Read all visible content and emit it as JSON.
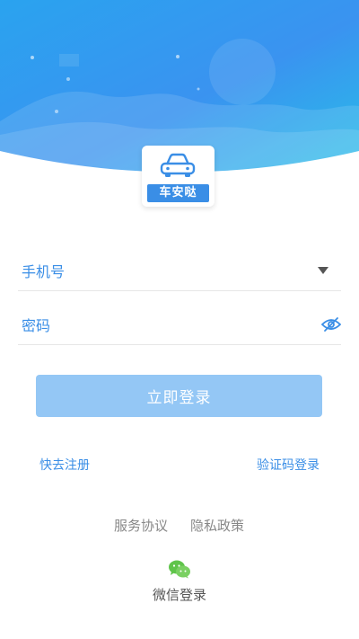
{
  "colors": {
    "accent": "#3a8ee6",
    "hero_top": "#29b6ee",
    "hero_bottom": "#3d8ff0",
    "button_disabled": "#94c7f5"
  },
  "logo": {
    "icon": "car-icon",
    "app_name": "车安哒"
  },
  "form": {
    "phone_placeholder": "手机号",
    "phone_value": "",
    "phone_dropdown_icon": "triangle-down-icon",
    "password_placeholder": "密码",
    "password_value": "",
    "password_toggle_icon": "eye-hidden-icon",
    "login_label": "立即登录"
  },
  "links": {
    "register": "快去注册",
    "sms_login": "验证码登录"
  },
  "footer": {
    "service_agreement": "服务协议",
    "privacy_policy": "隐私政策",
    "wechat_icon": "wechat-icon",
    "wechat_login": "微信登录"
  }
}
